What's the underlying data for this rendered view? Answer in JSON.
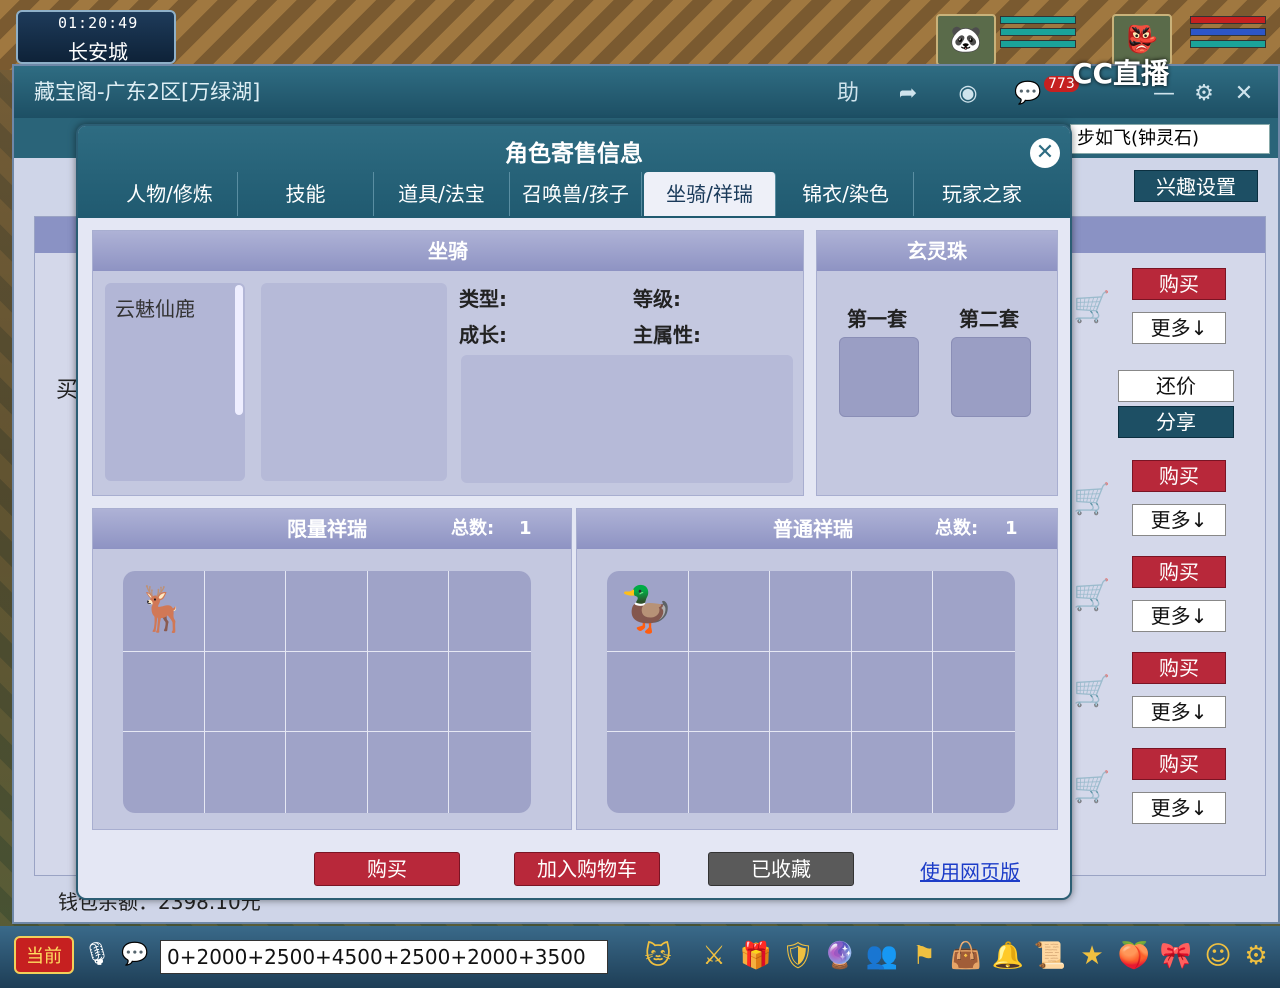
{
  "hud": {
    "time": "01:20:49",
    "city": "长安城",
    "stream_logo": "CC直播"
  },
  "treasure_window": {
    "title": "藏宝阁-广东2区[万绿湖]",
    "help_label": "助",
    "badge_count": "773",
    "search_value": "步如飞(钟灵石)",
    "interest_label": "兴趣设置",
    "side_char": "买",
    "balance_label": "钱包余额：2398.10元",
    "list_buttons": {
      "buy": "购买",
      "more": "更多↓",
      "counter": "还价",
      "share": "分享"
    }
  },
  "dialog": {
    "title": "角色寄售信息",
    "tabs": [
      "人物/修炼",
      "技能",
      "道具/法宝",
      "召唤兽/孩子",
      "坐骑/祥瑞",
      "锦衣/染色",
      "玩家之家"
    ],
    "active_tab": 4,
    "mount_panel": {
      "title": "坐骑",
      "mounts": [
        "云魅仙鹿"
      ],
      "type_label": "类型:",
      "level_label": "等级:",
      "growth_label": "成长:",
      "main_attr_label": "主属性:"
    },
    "orb_panel": {
      "title": "玄灵珠",
      "set1": "第一套",
      "set2": "第二套"
    },
    "limited_panel": {
      "title": "限量祥瑞",
      "total_label": "总数:",
      "total": "1"
    },
    "normal_panel": {
      "title": "普通祥瑞",
      "total_label": "总数:",
      "total": "1"
    },
    "buttons": {
      "buy": "购买",
      "add_cart": "加入购物车",
      "favorited": "已收藏",
      "web_version": "使用网页版"
    }
  },
  "bottom_bar": {
    "now_label": "当前",
    "chat_value": "0+2000+2500+4500+2500+2000+3500"
  },
  "colors": {
    "teal_header": "#2e6c82",
    "buy_red": "#b8283a",
    "panel_lavender": "#c4c8e0"
  }
}
